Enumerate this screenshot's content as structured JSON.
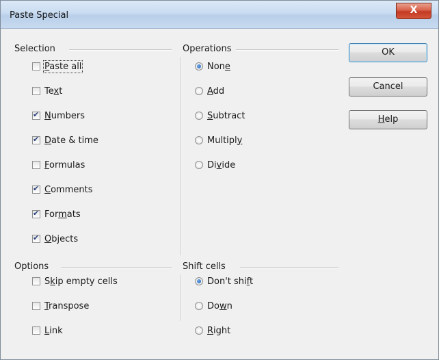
{
  "window": {
    "title": "Paste Special",
    "close_label": "X"
  },
  "selection": {
    "label": "Selection",
    "items": [
      {
        "pre": "",
        "ul": "P",
        "post": "aste all",
        "checked": false,
        "focused": true
      },
      {
        "pre": "Te",
        "ul": "x",
        "post": "t",
        "checked": false
      },
      {
        "pre": "",
        "ul": "N",
        "post": "umbers",
        "checked": true
      },
      {
        "pre": "",
        "ul": "D",
        "post": "ate & time",
        "checked": true
      },
      {
        "pre": "",
        "ul": "F",
        "post": "ormulas",
        "checked": false
      },
      {
        "pre": "",
        "ul": "C",
        "post": "omments",
        "checked": true
      },
      {
        "pre": "For",
        "ul": "m",
        "post": "ats",
        "checked": true
      },
      {
        "pre": "",
        "ul": "O",
        "post": "bjects",
        "checked": true
      }
    ]
  },
  "operations": {
    "label": "Operations",
    "items": [
      {
        "pre": "Non",
        "ul": "e",
        "post": "",
        "checked": true
      },
      {
        "pre": "",
        "ul": "A",
        "post": "dd",
        "checked": false
      },
      {
        "pre": "",
        "ul": "S",
        "post": "ubtract",
        "checked": false
      },
      {
        "pre": "Multipl",
        "ul": "y",
        "post": "",
        "checked": false
      },
      {
        "pre": "Di",
        "ul": "v",
        "post": "ide",
        "checked": false
      }
    ]
  },
  "options": {
    "label": "Options",
    "items": [
      {
        "pre": "S",
        "ul": "k",
        "post": "ip empty cells",
        "checked": false
      },
      {
        "pre": "",
        "ul": "T",
        "post": "ranspose",
        "checked": false
      },
      {
        "pre": "",
        "ul": "L",
        "post": "ink",
        "checked": false
      }
    ]
  },
  "shift_cells": {
    "label": "Shift cells",
    "items": [
      {
        "pre": "Don't shi",
        "ul": "f",
        "post": "t",
        "checked": true
      },
      {
        "pre": "Do",
        "ul": "w",
        "post": "n",
        "checked": false
      },
      {
        "pre": "",
        "ul": "R",
        "post": "ight",
        "checked": false
      }
    ]
  },
  "buttons": {
    "ok": "OK",
    "cancel": "Cancel",
    "help": {
      "pre": "",
      "ul": "H",
      "post": "elp"
    }
  }
}
